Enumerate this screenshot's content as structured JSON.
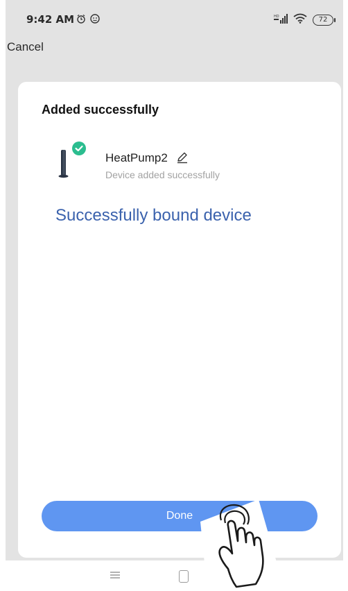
{
  "status_bar": {
    "time": "9:42 AM",
    "left_icons": [
      "alarm-icon",
      "face-icon"
    ],
    "right_icons": [
      "signal-icon",
      "wifi-icon"
    ],
    "battery": "72"
  },
  "header": {
    "cancel_label": "Cancel"
  },
  "card": {
    "title": "Added successfully",
    "device": {
      "name": "HeatPump2",
      "status": "Device added successfully",
      "badge_icon": "check-circle-icon",
      "edit_icon": "pencil-icon"
    },
    "annotation": "Successfully bound device",
    "done_label": "Done"
  },
  "nav_bar": {
    "icons": [
      "menu-icon",
      "home-icon"
    ]
  },
  "colors": {
    "accent": "#5f96f1",
    "success": "#2bbd8f",
    "annotation": "#3b62ad",
    "background": "#e3e3e3"
  }
}
